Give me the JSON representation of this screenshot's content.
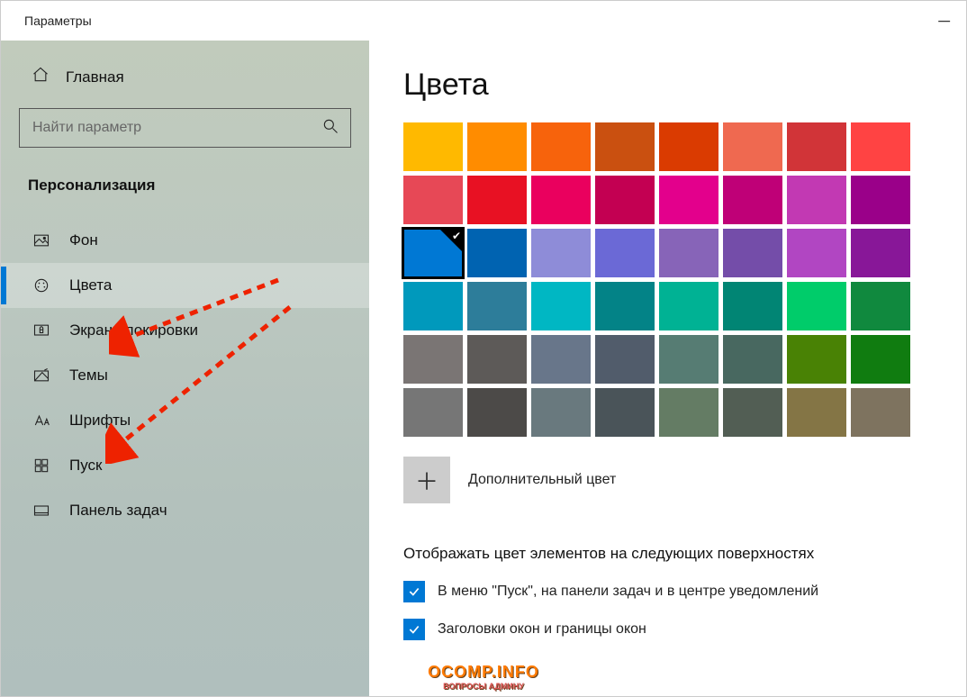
{
  "window": {
    "title": "Параметры"
  },
  "home": {
    "label": "Главная"
  },
  "search": {
    "placeholder": "Найти параметр"
  },
  "section": {
    "label": "Персонализация"
  },
  "nav": {
    "items": [
      {
        "id": "background",
        "label": "Фон"
      },
      {
        "id": "colors",
        "label": "Цвета",
        "selected": true
      },
      {
        "id": "lockscreen",
        "label": "Экран блокировки"
      },
      {
        "id": "themes",
        "label": "Темы"
      },
      {
        "id": "fonts",
        "label": "Шрифты"
      },
      {
        "id": "start",
        "label": "Пуск"
      },
      {
        "id": "taskbar",
        "label": "Панель задач"
      }
    ]
  },
  "page": {
    "title": "Цвета"
  },
  "palette": {
    "selected_index": 16,
    "colors": [
      "#FFB900",
      "#FF8C00",
      "#F7630C",
      "#CA5010",
      "#DA3B01",
      "#EF6950",
      "#D13438",
      "#FF4343",
      "#E74856",
      "#E81123",
      "#EA005E",
      "#C30052",
      "#E3008C",
      "#BF0077",
      "#C239B3",
      "#9A0089",
      "#0078D4",
      "#0063B1",
      "#8E8CD8",
      "#6B69D6",
      "#8764B8",
      "#744DA9",
      "#B146C2",
      "#881798",
      "#0099BC",
      "#2D7D9A",
      "#00B7C3",
      "#038387",
      "#00B294",
      "#018574",
      "#00CC6A",
      "#10893E",
      "#7A7574",
      "#5D5A58",
      "#68768A",
      "#515C6B",
      "#567C73",
      "#486860",
      "#498205",
      "#107C10",
      "#767676",
      "#4C4A48",
      "#69797E",
      "#4A5459",
      "#647C64",
      "#525E54",
      "#847545",
      "#7E735F"
    ]
  },
  "custom_color": {
    "label": "Дополнительный цвет"
  },
  "surfaces": {
    "heading": "Отображать цвет элементов на следующих поверхностях",
    "options": [
      {
        "label": "В меню \"Пуск\", на панели задач и в центре уведомлений",
        "checked": true
      },
      {
        "label": "Заголовки окон и границы окон",
        "checked": true
      }
    ]
  },
  "watermark": {
    "main": "OCOMP.INFO",
    "sub": "ВОПРОСЫ АДМИНУ"
  }
}
